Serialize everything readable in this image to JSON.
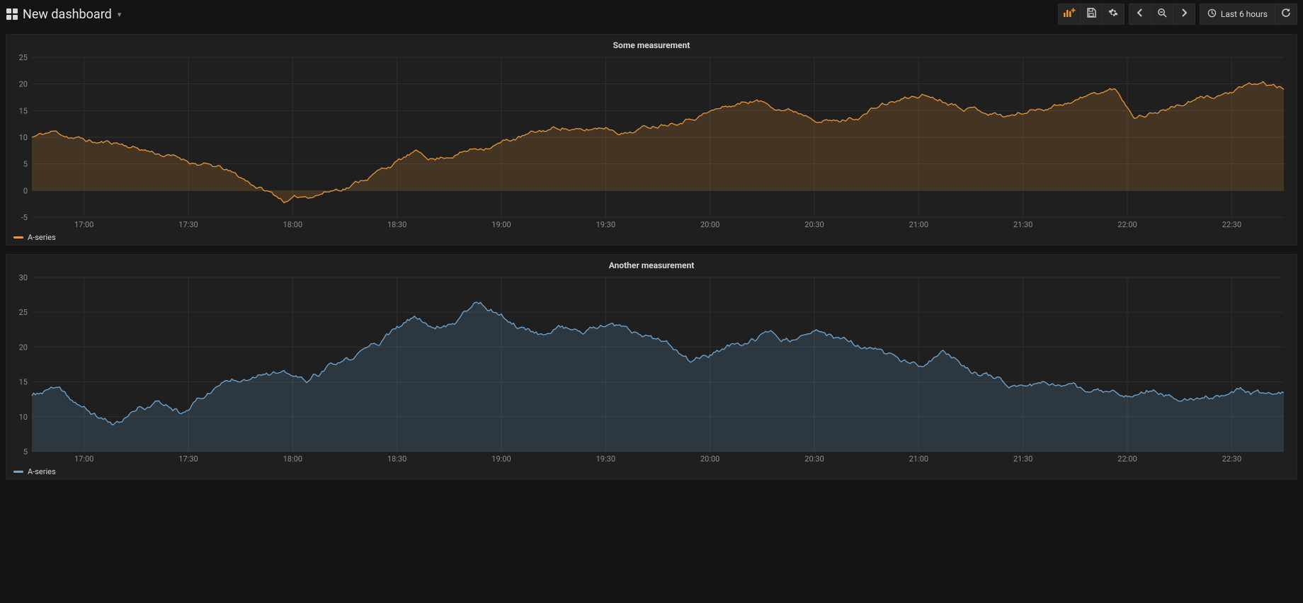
{
  "header": {
    "title": "New dashboard",
    "timerange_label": "Last 6 hours"
  },
  "panels": [
    {
      "title": "Some measurement",
      "legend_label": "A-series",
      "color": "#e8973a"
    },
    {
      "title": "Another measurement",
      "legend_label": "A-series",
      "color": "#6fa8d6"
    }
  ],
  "colors": {
    "series_orange": "#e8973a",
    "series_blue": "#6fa8d6",
    "fill_orange": "rgba(232,151,58,0.18)",
    "fill_blue": "rgba(111,168,214,0.18)"
  },
  "chart_data": [
    {
      "type": "area",
      "title": "Some measurement",
      "xlabel": "",
      "ylabel": "",
      "ylim": [
        -5,
        25
      ],
      "xticks": [
        "17:00",
        "17:30",
        "18:00",
        "18:30",
        "19:00",
        "19:30",
        "20:00",
        "20:30",
        "21:00",
        "21:30",
        "22:00",
        "22:30"
      ],
      "yticks": [
        -5,
        0,
        5,
        10,
        15,
        20,
        25
      ],
      "series": [
        {
          "name": "A-series",
          "color": "#e8973a",
          "values": [
            10,
            11,
            10,
            9,
            9,
            8,
            7,
            6,
            5,
            4,
            2,
            0,
            -2,
            -1,
            0,
            1,
            3,
            5,
            7,
            6,
            7,
            8,
            9,
            10,
            11,
            12,
            11,
            12,
            11,
            12,
            13,
            14,
            15,
            16,
            17,
            16,
            15,
            14,
            13,
            14,
            16,
            17,
            18,
            17,
            16,
            15,
            14,
            15,
            16,
            17,
            18,
            19,
            14,
            15,
            16,
            17,
            18,
            19,
            20,
            19
          ]
        }
      ]
    },
    {
      "type": "area",
      "title": "Another measurement",
      "xlabel": "",
      "ylabel": "",
      "ylim": [
        5,
        30
      ],
      "xticks": [
        "17:00",
        "17:30",
        "18:00",
        "18:30",
        "19:00",
        "19:30",
        "20:00",
        "20:30",
        "21:00",
        "21:30",
        "22:00",
        "22:30"
      ],
      "yticks": [
        5,
        10,
        15,
        20,
        25,
        30
      ],
      "series": [
        {
          "name": "A-series",
          "color": "#6fa8d6",
          "values": [
            13,
            14,
            12,
            10,
            9,
            11,
            12,
            11,
            13,
            15,
            16,
            17,
            16,
            15,
            17,
            18,
            20,
            22,
            24,
            23,
            24,
            27,
            25,
            23,
            22,
            23,
            22,
            23,
            22,
            21,
            20,
            18,
            19,
            20,
            21,
            22,
            21,
            22,
            21,
            20,
            19,
            18,
            17,
            19,
            17,
            16,
            15,
            14,
            15,
            14,
            13,
            14,
            13,
            14,
            13,
            12,
            13,
            14,
            13,
            13
          ]
        }
      ]
    }
  ]
}
